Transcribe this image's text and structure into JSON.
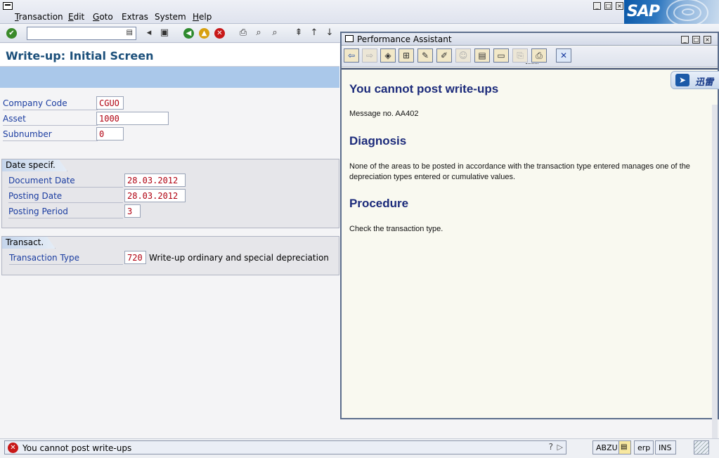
{
  "menu": {
    "items": [
      {
        "first": "T",
        "rest": "ransaction"
      },
      {
        "first": "E",
        "rest": "dit"
      },
      {
        "first": "G",
        "rest": "oto"
      },
      {
        "first": "",
        "rest": "Extras"
      },
      {
        "first": "",
        "rest": "System"
      },
      {
        "first": "H",
        "rest": "elp"
      }
    ]
  },
  "brand": {
    "logo": "SAP"
  },
  "toolbar": {
    "command_value": ""
  },
  "page": {
    "title": "Write-up: Initial Screen"
  },
  "fields": {
    "company_code": {
      "label": "Company Code",
      "value": "CGUO"
    },
    "asset": {
      "label": "Asset",
      "value": "1000"
    },
    "subnumber": {
      "label": "Subnumber",
      "value": "0"
    }
  },
  "date_group": {
    "title": "Date specif.",
    "document_date": {
      "label": "Document Date",
      "value": "28.03.2012"
    },
    "posting_date": {
      "label": "Posting Date",
      "value": "28.03.2012"
    },
    "posting_period": {
      "label": "Posting Period",
      "value": "3"
    }
  },
  "transact_group": {
    "title": "Transact.",
    "transaction_type": {
      "label": "Transaction Type",
      "value": "720",
      "description": "Write-up ordinary and special depreciation"
    }
  },
  "assistant": {
    "title": "Performance Assistant",
    "heading": "You cannot post write-ups",
    "message_no": "Message no. AA402",
    "diagnosis_heading": "Diagnosis",
    "diagnosis_text": "None of the areas to be posted in accordance with the transaction type entered manages one of the depreciation types entered or cumulative values.",
    "procedure_heading": "Procedure",
    "procedure_text": "Check the transaction type.",
    "xunlei_label": "迅雷"
  },
  "status": {
    "message": "You cannot post write-ups",
    "transaction": "ABZU",
    "system": "erp",
    "mode": "INS"
  },
  "colors": {
    "title_blue": "#1b4f7a",
    "label_blue": "#1a3ca0",
    "value_red": "#b00010",
    "header_band": "#aac8ea",
    "error_red": "#c81818"
  }
}
